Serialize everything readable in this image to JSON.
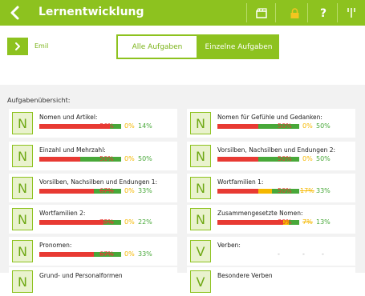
{
  "header": {
    "title": "Lernentwicklung"
  },
  "user": {
    "name": "Emil"
  },
  "segments": {
    "all": "Alle Aufgaben",
    "single": "Einzelne Aufgaben"
  },
  "overview_label": "Aufgabenübersicht:",
  "colors": {
    "green": "#8dc21f",
    "red": "#e83a33",
    "yellow": "#f5b800",
    "dark_green": "#48a839"
  },
  "tasks": [
    {
      "badge": "N",
      "name": "Nomen und Artikel:",
      "red": 86,
      "yellow": 0,
      "green": 14,
      "red_label": "86%",
      "yellow_label": "0%",
      "green_label": "14%",
      "red_struck": false,
      "yellow_struck": false
    },
    {
      "badge": "N",
      "name": "Nomen für Gefühle und Gedanken:",
      "red": 50,
      "yellow": 0,
      "green": 50,
      "red_label": "50%",
      "yellow_label": "0%",
      "green_label": "50%",
      "red_struck": false,
      "yellow_struck": false
    },
    {
      "badge": "N",
      "name": "Einzahl und Mehrzahl:",
      "red": 50,
      "yellow": 0,
      "green": 50,
      "red_label": "50%",
      "yellow_label": "0%",
      "green_label": "50%",
      "red_struck": false,
      "yellow_struck": false
    },
    {
      "badge": "N",
      "name": "Vorsilben, Nachsilben und Endungen 2:",
      "red": 50,
      "yellow": 0,
      "green": 50,
      "red_label": "50%",
      "yellow_label": "0%",
      "green_label": "50%",
      "red_struck": false,
      "yellow_struck": false
    },
    {
      "badge": "N",
      "name": "Vorsilben, Nachsilben und Endungen 1:",
      "red": 67,
      "yellow": 0,
      "green": 33,
      "red_label": "67%",
      "yellow_label": "0%",
      "green_label": "33%",
      "red_struck": true,
      "yellow_struck": false
    },
    {
      "badge": "N",
      "name": "Wortfamilien 1:",
      "red": 50,
      "yellow": 17,
      "green": 33,
      "red_label": "50%",
      "yellow_label": "17%",
      "green_label": "33%",
      "red_struck": false,
      "yellow_struck": true
    },
    {
      "badge": "N",
      "name": "Wortfamilien 2:",
      "red": 78,
      "yellow": 0,
      "green": 22,
      "red_label": "78%",
      "yellow_label": "0%",
      "green_label": "22%",
      "red_struck": true,
      "yellow_struck": false
    },
    {
      "badge": "N",
      "name": "Zusammengesetzte Nomen:",
      "red": 80,
      "yellow": 7,
      "green": 13,
      "red_label": "80%",
      "yellow_label": "7%",
      "green_label": "13%",
      "red_struck": false,
      "yellow_struck": true
    },
    {
      "badge": "N",
      "name": "Pronomen:",
      "red": 67,
      "yellow": 0,
      "green": 33,
      "red_label": "67%",
      "yellow_label": "0%",
      "green_label": "33%",
      "red_struck": true,
      "yellow_struck": false
    },
    {
      "badge": "V",
      "name": "Verben:",
      "red": 0,
      "yellow": 0,
      "green": 0,
      "red_label": "-",
      "yellow_label": "-",
      "green_label": "-",
      "red_struck": false,
      "yellow_struck": false,
      "empty": true
    },
    {
      "badge": "N",
      "name": "Grund- und Personalformen",
      "partial": true
    },
    {
      "badge": "V",
      "name": "Besondere Verben",
      "partial": true
    }
  ]
}
